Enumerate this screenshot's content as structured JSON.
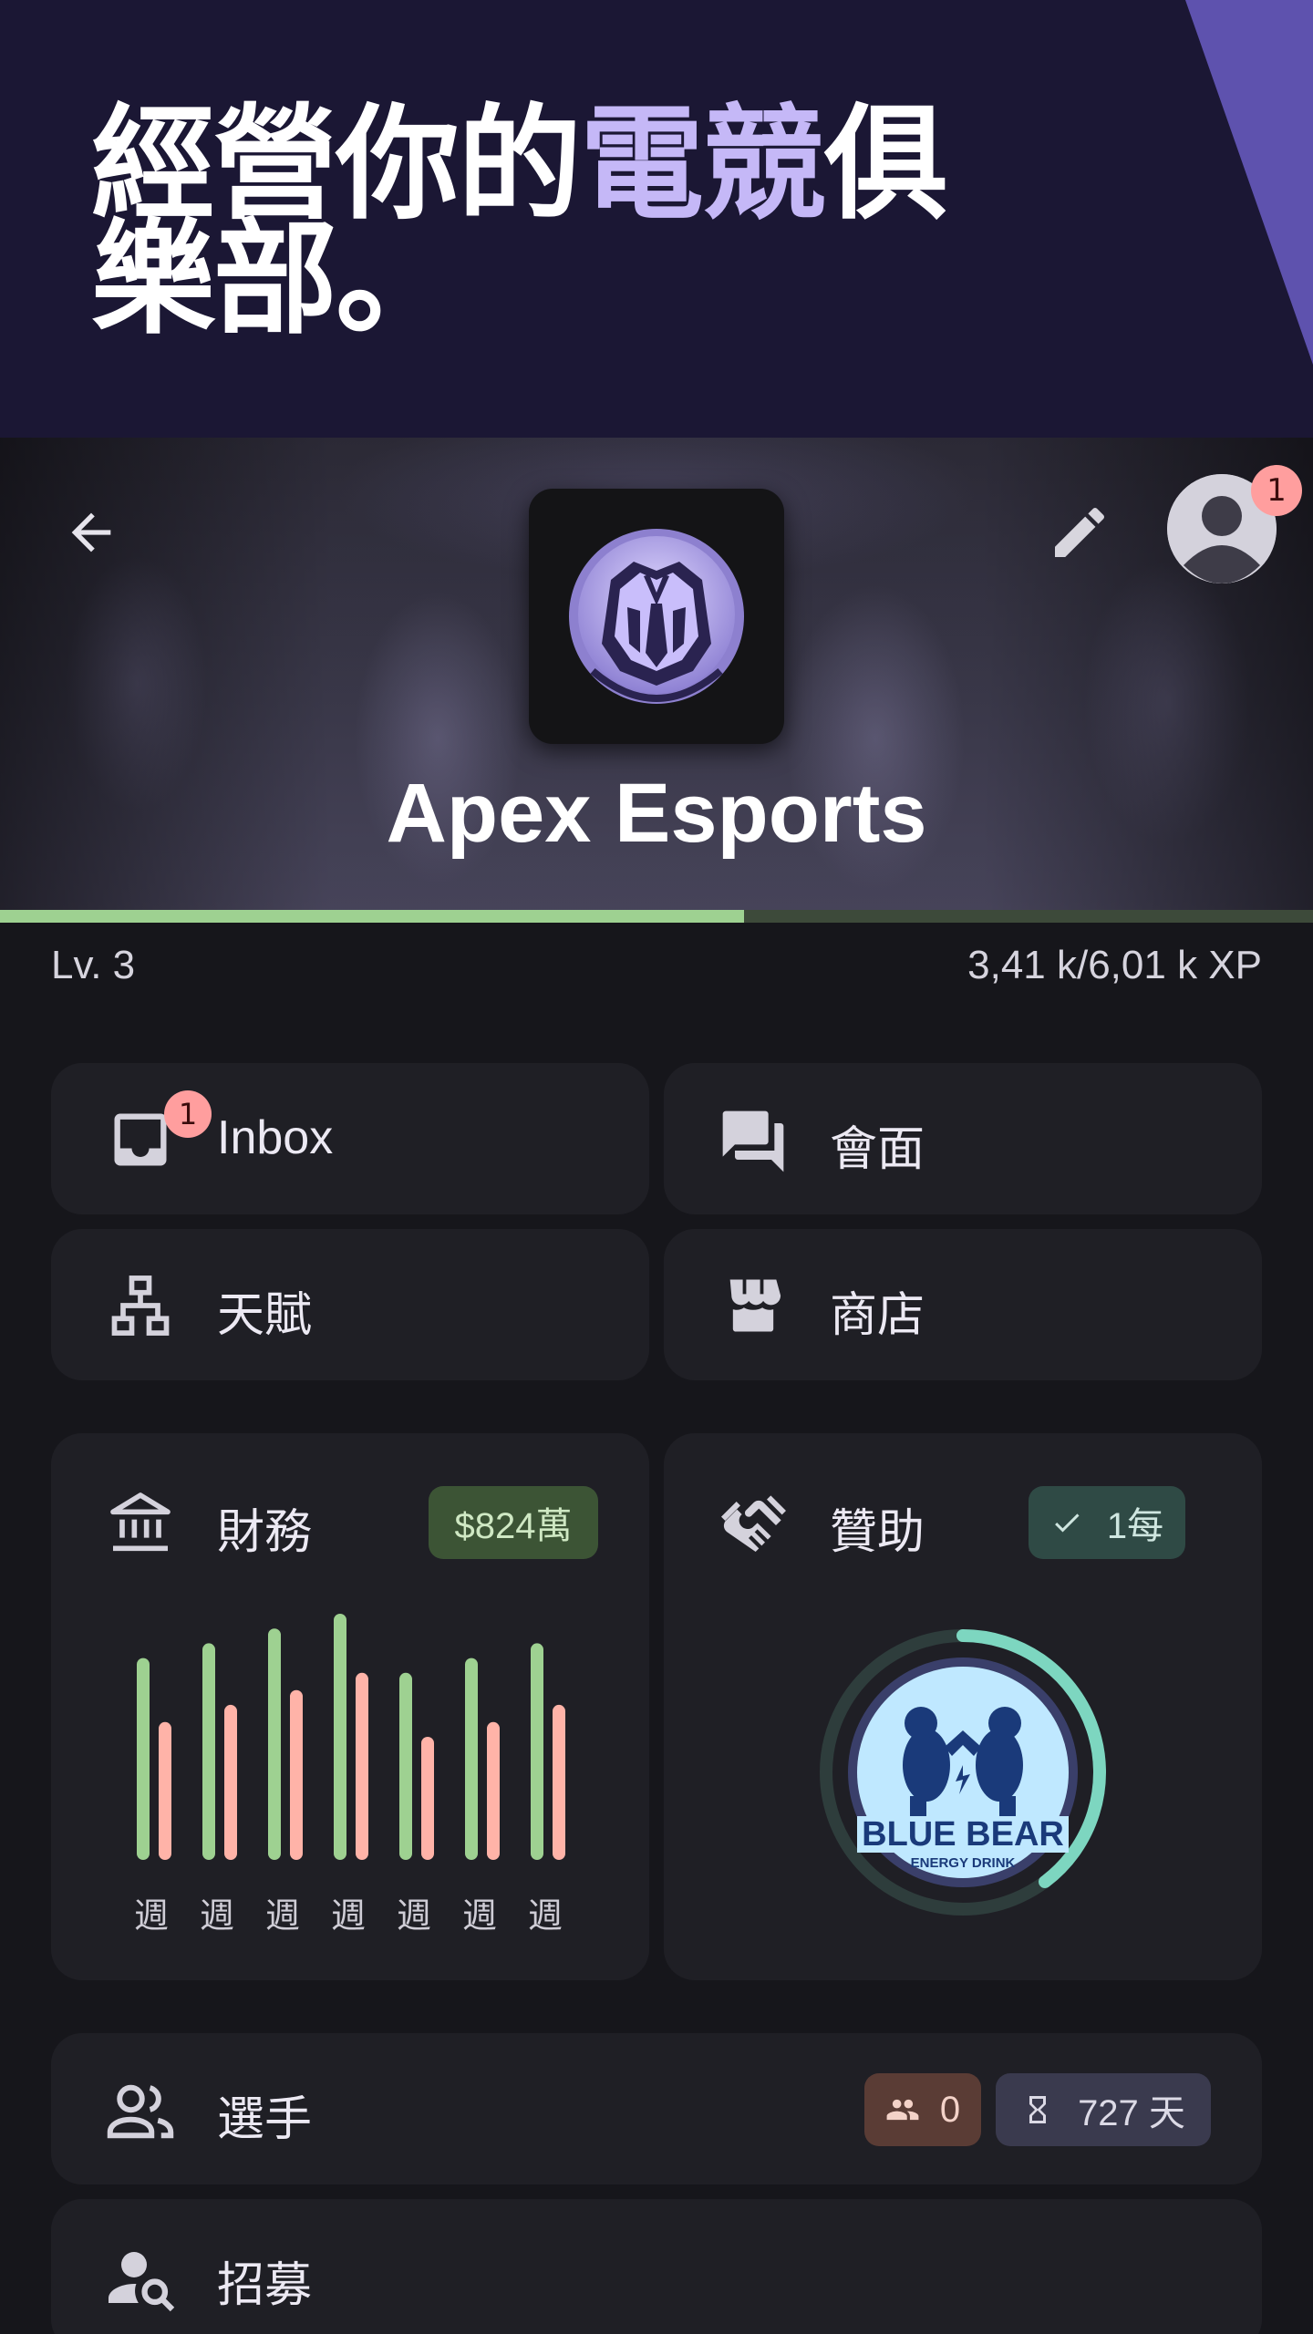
{
  "promo": {
    "title_part1": "經營你的",
    "title_accent": "電競",
    "title_part2": "俱樂部。"
  },
  "header": {
    "team_name": "Apex Esports",
    "notification_count": "1"
  },
  "progress": {
    "level_label": "Lv.  3",
    "xp_text": "3,41 k/6,01 k XP",
    "xp_fraction": 0.567
  },
  "menu": {
    "inbox_label": "Inbox",
    "inbox_badge": "1",
    "meetings_label": "會面",
    "talents_label": "天賦",
    "shop_label": "商店"
  },
  "finance": {
    "label": "財務",
    "balance": "$824萬",
    "week_labels": [
      "週",
      "週",
      "週",
      "週",
      "週",
      "週",
      "週"
    ],
    "income_levels": [
      0.82,
      0.88,
      0.94,
      1.0,
      0.76,
      0.82,
      0.88
    ],
    "expense_levels": [
      0.56,
      0.63,
      0.69,
      0.76,
      0.5,
      0.56,
      0.63
    ]
  },
  "sponsor": {
    "label": "贊助",
    "status_chip": "1每",
    "logo_text": "BLUE BEAR",
    "logo_subtext": "ENERGY DRINK"
  },
  "players": {
    "label": "選手",
    "player_count": "0",
    "days_left": "727 天"
  },
  "recruit": {
    "label": "招募"
  },
  "colors": {
    "accent": "#c5b8f7",
    "income": "#9ed191",
    "expense": "#ffb3a8",
    "badge": "#ff9e9e",
    "sponsor_ring": "#7dd6c0"
  }
}
